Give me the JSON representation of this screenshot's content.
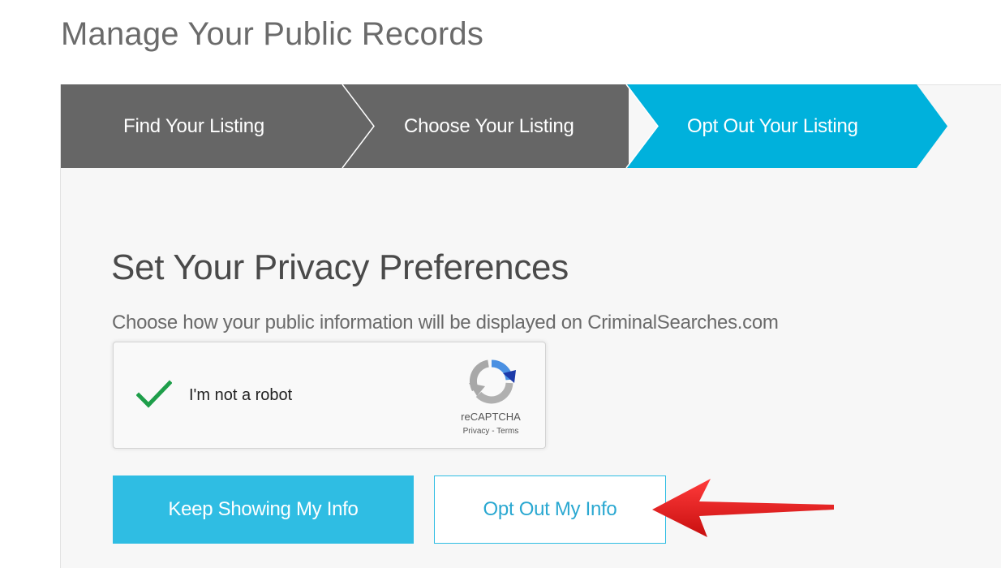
{
  "page": {
    "title": "Manage Your Public Records"
  },
  "stepper": {
    "steps": [
      {
        "label": "Find Your Listing",
        "state": "complete"
      },
      {
        "label": "Choose Your Listing",
        "state": "complete"
      },
      {
        "label": "Opt Out Your Listing",
        "state": "active"
      }
    ],
    "colors": {
      "inactive": "#666666",
      "active": "#00b1dc",
      "divider": "#ffffff"
    }
  },
  "preferences": {
    "title": "Set Your Privacy Preferences",
    "subtitle": "Choose how your public information will be displayed on CriminalSearches.com"
  },
  "recaptcha": {
    "label": "I'm not a robot",
    "checked": true,
    "brand": "reCAPTCHA",
    "privacy_link": "Privacy",
    "separator": " - ",
    "terms_link": "Terms",
    "check_color": "#1e9e4a"
  },
  "actions": {
    "keep_label": "Keep Showing My Info",
    "optout_label": "Opt Out My Info",
    "accent_color": "#2fbde3"
  },
  "annotation": {
    "arrow_icon": "red-arrow-icon",
    "arrow_color": "#e31b1b"
  }
}
